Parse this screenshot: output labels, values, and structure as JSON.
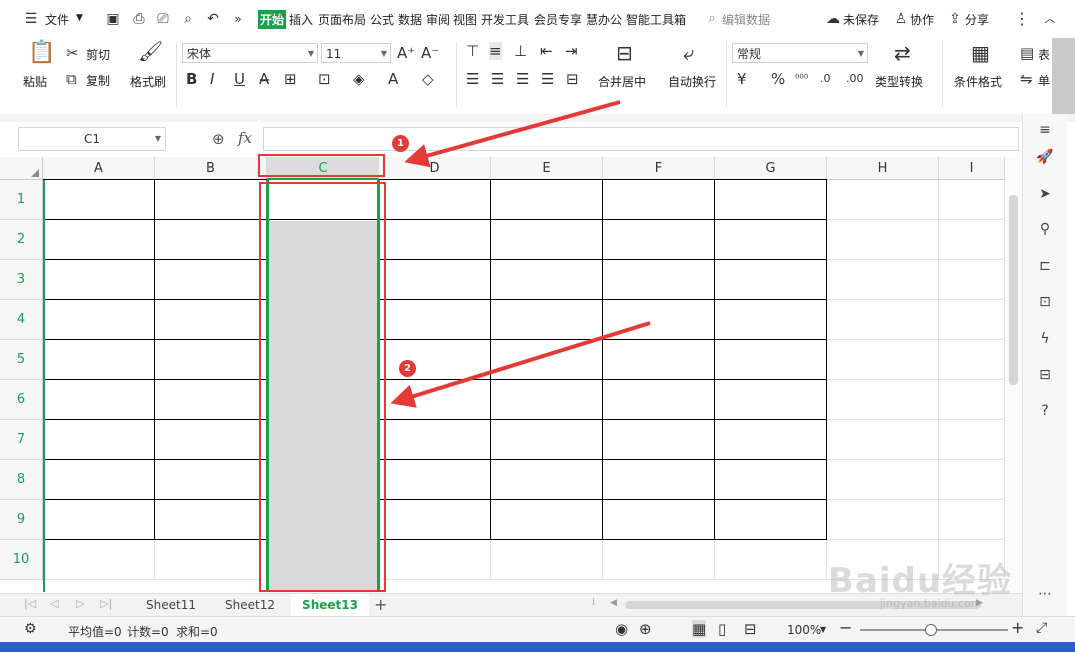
{
  "menu": {
    "file_label": "文件",
    "tabs": [
      "开始",
      "插入",
      "页面布局",
      "公式",
      "数据",
      "审阅",
      "视图",
      "开发工具",
      "会员专享",
      "慧办公",
      "智能工具箱"
    ],
    "search_placeholder": "编辑数据",
    "unsaved_label": "未保存",
    "collab_label": "协作",
    "share_label": "分享"
  },
  "ribbon": {
    "paste": "粘贴",
    "cut": "剪切",
    "copy": "复制",
    "format_painter": "格式刷",
    "font_name": "宋体",
    "font_size": "11",
    "merge_center": "合并居中",
    "wrap_text": "自动换行",
    "number_format": "常规",
    "type_convert": "类型转换",
    "conditional_format": "条件格式",
    "table_label": "表",
    "single_label": "单"
  },
  "formula_bar": {
    "cell_ref": "C1",
    "fx_label": "fx",
    "content": ""
  },
  "grid": {
    "columns": [
      "A",
      "B",
      "C",
      "D",
      "E",
      "F",
      "G",
      "H",
      "I"
    ],
    "rows": [
      "1",
      "2",
      "3",
      "4",
      "5",
      "6",
      "7",
      "8",
      "9",
      "10"
    ],
    "selected_column": "C"
  },
  "sheets": [
    "Sheet11",
    "Sheet12",
    "Sheet13"
  ],
  "active_sheet": "Sheet13",
  "status": {
    "average": "平均值=0",
    "count": "计数=0",
    "sum": "求和=0",
    "zoom": "100%"
  },
  "annotations": [
    "1",
    "2"
  ],
  "watermark": {
    "text": "Baidu经验",
    "url": "jingyan.baidu.com"
  },
  "colors": {
    "accent_green": "#16a34a",
    "annotation_red": "#e53935",
    "selection_gray": "#d9d9d9"
  }
}
